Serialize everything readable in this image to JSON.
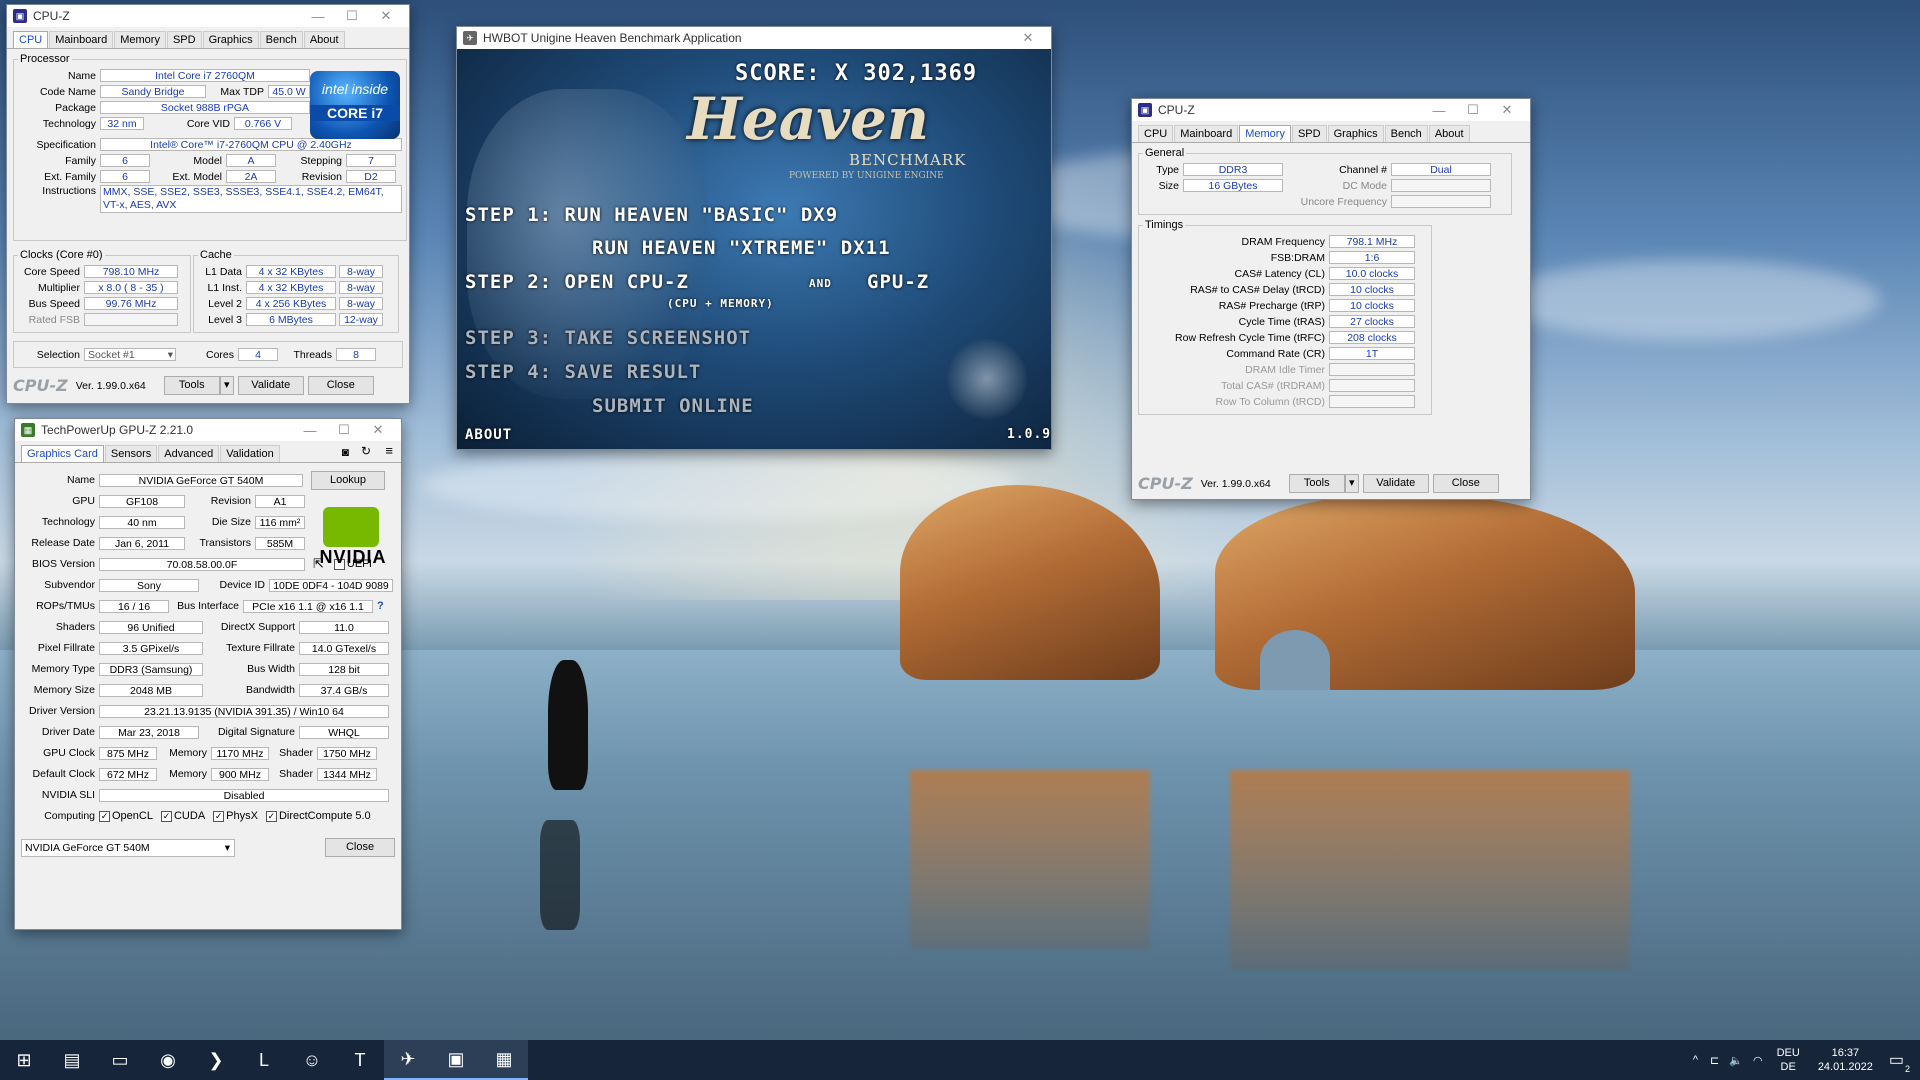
{
  "cpuz_cpu": {
    "title": "CPU-Z",
    "tabs": [
      "CPU",
      "Mainboard",
      "Memory",
      "SPD",
      "Graphics",
      "Bench",
      "About"
    ],
    "active_tab": "CPU",
    "processor_legend": "Processor",
    "name_label": "Name",
    "name": "Intel Core i7 2760QM",
    "codename_label": "Code Name",
    "codename": "Sandy Bridge",
    "maxtdp_label": "Max TDP",
    "maxtdp": "45.0 W",
    "package_label": "Package",
    "package": "Socket 988B rPGA",
    "technology_label": "Technology",
    "technology": "32 nm",
    "corevid_label": "Core VID",
    "corevid": "0.766 V",
    "spec_label": "Specification",
    "spec": "Intel® Core™ i7-2760QM CPU @ 2.40GHz",
    "family_label": "Family",
    "family": "6",
    "model_label": "Model",
    "model": "A",
    "stepping_label": "Stepping",
    "stepping": "7",
    "extfamily_label": "Ext. Family",
    "extfamily": "6",
    "extmodel_label": "Ext. Model",
    "extmodel": "2A",
    "revision_label": "Revision",
    "revision": "D2",
    "instructions_label": "Instructions",
    "instructions": "MMX, SSE, SSE2, SSE3, SSSE3, SSE4.1, SSE4.2, EM64T, VT-x, AES, AVX",
    "clocks_legend": "Clocks (Core #0)",
    "corespeed_label": "Core Speed",
    "corespeed": "798.10 MHz",
    "multiplier_label": "Multiplier",
    "multiplier": "x 8.0 ( 8 - 35 )",
    "busspeed_label": "Bus Speed",
    "busspeed": "99.76 MHz",
    "ratedfsb_label": "Rated FSB",
    "ratedfsb": "",
    "cache_legend": "Cache",
    "l1data_label": "L1 Data",
    "l1data": "4 x 32 KBytes",
    "l1data_way": "8-way",
    "l1inst_label": "L1 Inst.",
    "l1inst": "4 x 32 KBytes",
    "l1inst_way": "8-way",
    "l2_label": "Level 2",
    "l2": "4 x 256 KBytes",
    "l2_way": "8-way",
    "l3_label": "Level 3",
    "l3": "6 MBytes",
    "l3_way": "12-way",
    "selection_label": "Selection",
    "selection": "Socket #1",
    "cores_label": "Cores",
    "cores": "4",
    "threads_label": "Threads",
    "threads": "8",
    "intel_inside": "intel inside",
    "intel_core": "CORE i7",
    "brand": "CPU-Z",
    "version": "Ver. 1.99.0.x64",
    "tools": "Tools",
    "validate": "Validate",
    "close": "Close"
  },
  "gpuz": {
    "title": "TechPowerUp GPU-Z 2.21.0",
    "tabs": [
      "Graphics Card",
      "Sensors",
      "Advanced",
      "Validation"
    ],
    "active_tab": "Graphics Card",
    "name_label": "Name",
    "name": "NVIDIA GeForce GT 540M",
    "lookup": "Lookup",
    "gpu_label": "GPU",
    "gpu": "GF108",
    "revision_label": "Revision",
    "revision": "A1",
    "technology_label": "Technology",
    "technology": "40 nm",
    "diesize_label": "Die Size",
    "diesize": "116 mm²",
    "releasedate_label": "Release Date",
    "releasedate": "Jan 6, 2011",
    "transistors_label": "Transistors",
    "transistors": "585M",
    "bios_label": "BIOS Version",
    "bios": "70.08.58.00.0F",
    "uefi_label": "UEFI",
    "subvendor_label": "Subvendor",
    "subvendor": "Sony",
    "deviceid_label": "Device ID",
    "deviceid": "10DE 0DF4 - 104D 9089",
    "rops_label": "ROPs/TMUs",
    "rops": "16 / 16",
    "busif_label": "Bus Interface",
    "busif": "PCIe x16 1.1 @ x16 1.1",
    "help": "?",
    "shaders_label": "Shaders",
    "shaders": "96 Unified",
    "directx_label": "DirectX Support",
    "directx": "11.0",
    "pixelfill_label": "Pixel Fillrate",
    "pixelfill": "3.5 GPixel/s",
    "texfill_label": "Texture Fillrate",
    "texfill": "14.0 GTexel/s",
    "memtype_label": "Memory Type",
    "memtype": "DDR3 (Samsung)",
    "buswidth_label": "Bus Width",
    "buswidth": "128 bit",
    "memsize_label": "Memory Size",
    "memsize": "2048 MB",
    "bandwidth_label": "Bandwidth",
    "bandwidth": "37.4 GB/s",
    "driverver_label": "Driver Version",
    "driverver": "23.21.13.9135 (NVIDIA 391.35) / Win10 64",
    "driverdate_label": "Driver Date",
    "driverdate": "Mar 23, 2018",
    "digsig_label": "Digital Signature",
    "digsig": "WHQL",
    "gpuclock_label": "GPU Clock",
    "gpuclock": "875 MHz",
    "memory_label": "Memory",
    "memclock": "1170 MHz",
    "shader_label": "Shader",
    "shaderclock": "1750 MHz",
    "defclock_label": "Default Clock",
    "defclock": "672 MHz",
    "defmem": "900 MHz",
    "defshader": "1344 MHz",
    "sli_label": "NVIDIA SLI",
    "sli": "Disabled",
    "computing_label": "Computing",
    "computing": [
      "OpenCL",
      "CUDA",
      "PhysX",
      "DirectCompute 5.0"
    ],
    "check": "✓",
    "nvidia": "NVIDIA",
    "select": "NVIDIA GeForce GT 540M",
    "close": "Close"
  },
  "heaven": {
    "title": "HWBOT Unigine Heaven Benchmark Application",
    "score": "SCORE:  X 302,1369",
    "logo": "Heaven",
    "logo_sub": "BENCHMARK",
    "logo_powered": "POWERED BY UNIGINE ENGINE",
    "step1": "STEP 1:  RUN HEAVEN \"BASIC\" DX9",
    "step1b": "RUN HEAVEN \"XTREME\" DX11",
    "step2": "STEP 2: OPEN CPU-Z",
    "step2_and": "AND",
    "step2_gpuz": "GPU-Z",
    "step2_sub": "(CPU + MEMORY)",
    "step3": "STEP 3:  TAKE SCREENSHOT",
    "step4": "STEP 4:  SAVE RESULT",
    "step4b": "SUBMIT ONLINE",
    "about": "ABOUT",
    "version": "1.0.9"
  },
  "cpuz_mem": {
    "title": "CPU-Z",
    "tabs": [
      "CPU",
      "Mainboard",
      "Memory",
      "SPD",
      "Graphics",
      "Bench",
      "About"
    ],
    "active_tab": "Memory",
    "general_legend": "General",
    "type_label": "Type",
    "type": "DDR3",
    "size_label": "Size",
    "size": "16 GBytes",
    "channel_label": "Channel #",
    "channel": "Dual",
    "dcmode_label": "DC Mode",
    "dcmode": "",
    "uncore_label": "Uncore Frequency",
    "uncore": "",
    "timings_legend": "Timings",
    "timings": [
      {
        "label": "DRAM Frequency",
        "value": "798.1 MHz",
        "dim": false
      },
      {
        "label": "FSB:DRAM",
        "value": "1:6",
        "dim": false
      },
      {
        "label": "CAS# Latency (CL)",
        "value": "10.0 clocks",
        "dim": false
      },
      {
        "label": "RAS# to CAS# Delay (tRCD)",
        "value": "10 clocks",
        "dim": false
      },
      {
        "label": "RAS# Precharge (tRP)",
        "value": "10 clocks",
        "dim": false
      },
      {
        "label": "Cycle Time (tRAS)",
        "value": "27 clocks",
        "dim": false
      },
      {
        "label": "Row Refresh Cycle Time (tRFC)",
        "value": "208 clocks",
        "dim": false
      },
      {
        "label": "Command Rate (CR)",
        "value": "1T",
        "dim": false
      },
      {
        "label": "DRAM Idle Timer",
        "value": "",
        "dim": true
      },
      {
        "label": "Total CAS# (tRDRAM)",
        "value": "",
        "dim": true
      },
      {
        "label": "Row To Column (tRCD)",
        "value": "",
        "dim": true
      }
    ],
    "brand": "CPU-Z",
    "version": "Ver. 1.99.0.x64",
    "tools": "Tools",
    "validate": "Validate",
    "close": "Close"
  },
  "taskbar": {
    "start_icon": "⊞",
    "apps": [
      {
        "name": "notepad-app-icon",
        "glyph": "▤"
      },
      {
        "name": "file-explorer-icon",
        "glyph": "▭"
      },
      {
        "name": "chrome-icon",
        "glyph": "◉"
      },
      {
        "name": "powershell-icon",
        "glyph": "❯"
      },
      {
        "name": "app-l-icon",
        "glyph": "L"
      },
      {
        "name": "discord-icon",
        "glyph": "☺"
      },
      {
        "name": "app-t-icon",
        "glyph": "T"
      },
      {
        "name": "heaven-app-icon",
        "glyph": "✈"
      },
      {
        "name": "cpuz-app-icon",
        "glyph": "▣"
      },
      {
        "name": "gpuz-app-icon",
        "glyph": "▦"
      }
    ],
    "tray_chevron": "^",
    "tray_network": "⊏",
    "tray_volume": "🔈",
    "tray_wifi": "◠",
    "lang_1": "DEU",
    "lang_2": "DE",
    "time": "16:37",
    "date": "24.01.2022",
    "notif_icon": "▭",
    "notif_count": "2"
  }
}
